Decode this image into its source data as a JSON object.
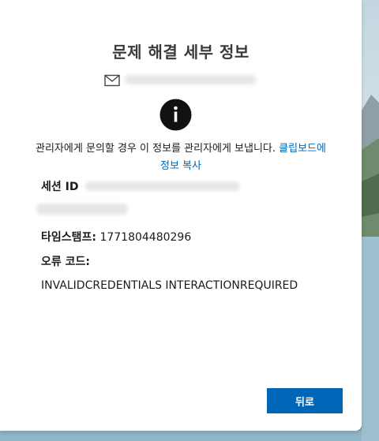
{
  "dialog": {
    "title": "문제 해결 세부 정보",
    "info_message": "관리자에게 문의할 경우 이 정보를 관리자에게 보냅니다.",
    "copy_link": "클립보드에 정보 복사",
    "session_label": "세션 ID",
    "timestamp_label": "타임스탬프:",
    "timestamp_value": "1771804480296",
    "error_code_label": "오류 코드:",
    "error_code_value": "INVALIDCREDENTIALS INTERACTIONREQUIRED",
    "back_button": "뒤로"
  },
  "icons": {
    "mail": "mail-icon",
    "info": "info-icon"
  },
  "colors": {
    "accent": "#0067b8",
    "text": "#1b1b1b"
  }
}
